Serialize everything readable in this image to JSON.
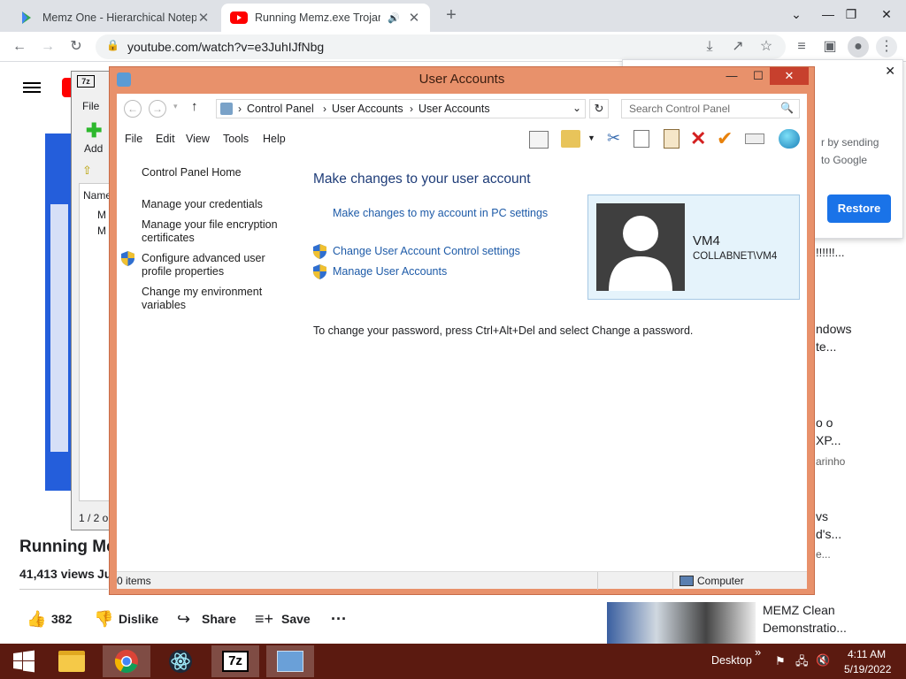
{
  "browser": {
    "tabs": [
      {
        "title": "Memz One - Hierarchical Notepa",
        "active": false
      },
      {
        "title": "Running Memz.exe Trojan o",
        "active": true
      }
    ],
    "new_tab": "+",
    "url": "youtube.com/watch?v=e3JuhIJfNbg"
  },
  "youtube": {
    "video_title": "Running Mem",
    "views": "41,413 views",
    "views_suffix": "Ju",
    "likes": "382",
    "dislike": "Dislike",
    "share": "Share",
    "save": "Save",
    "popup_text_1": "r by sending",
    "popup_text_2": "to Google",
    "restore_button": "Restore",
    "side_texts": [
      "!!!!!!...",
      "ndows",
      "te...",
      "o o",
      "XP...",
      "arinho",
      "vs",
      "d's...",
      "e...",
      "MEMZ Clean",
      "Demonstratio..."
    ]
  },
  "sevenzip": {
    "menu_file": "File",
    "add_label": "Add",
    "column_name": "Name",
    "row1": "M",
    "row2": "M",
    "status": "1 / 2 o"
  },
  "window": {
    "title": "User Accounts",
    "breadcrumb": [
      "Control Panel",
      "User Accounts",
      "User Accounts"
    ],
    "search_placeholder": "Search Control Panel",
    "menu": [
      "File",
      "Edit",
      "View",
      "Tools",
      "Help"
    ],
    "nav": {
      "home": "Control Panel Home",
      "credentials": "Manage your credentials",
      "encryption": "Manage your file encryption certificates",
      "profile": "Configure advanced user profile properties",
      "environment": "Change my environment variables"
    },
    "heading": "Make changes to your user account",
    "link_pc_settings": "Make changes to my account in PC settings",
    "link_uac": "Change User Account Control settings",
    "link_manage": "Manage User Accounts",
    "password_note": "To change your password, press Ctrl+Alt+Del and select Change a password.",
    "account": {
      "name": "VM4",
      "domain": "COLLABNET\\VM4"
    },
    "status_items": "0 items",
    "status_location": "Computer"
  },
  "taskbar": {
    "desktop_label": "Desktop",
    "chevron": "»",
    "time": "4:11 AM",
    "date": "5/19/2022"
  }
}
